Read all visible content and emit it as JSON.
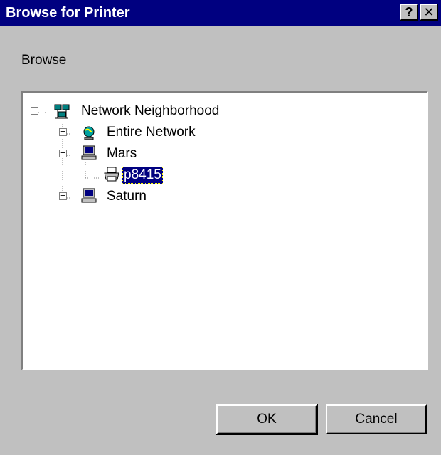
{
  "window": {
    "title": "Browse for Printer",
    "help_label": "?",
    "close_label": "✕"
  },
  "browse_label": "Browse",
  "tree": {
    "root": {
      "label": "Network Neighborhood",
      "icon": "network-neighborhood-icon",
      "expanded": true
    },
    "entire_network": {
      "label": "Entire Network",
      "icon": "globe-icon",
      "expanded": false
    },
    "mars": {
      "label": "Mars",
      "icon": "computer-icon",
      "expanded": true
    },
    "printer": {
      "label": "p8415",
      "icon": "printer-icon",
      "selected": true
    },
    "saturn": {
      "label": "Saturn",
      "icon": "computer-icon",
      "expanded": false
    }
  },
  "buttons": {
    "ok_label": "OK",
    "cancel_label": "Cancel"
  },
  "colors": {
    "titlebar": "#000080",
    "dialog_face": "#c0c0c0",
    "selection": "#000080"
  }
}
